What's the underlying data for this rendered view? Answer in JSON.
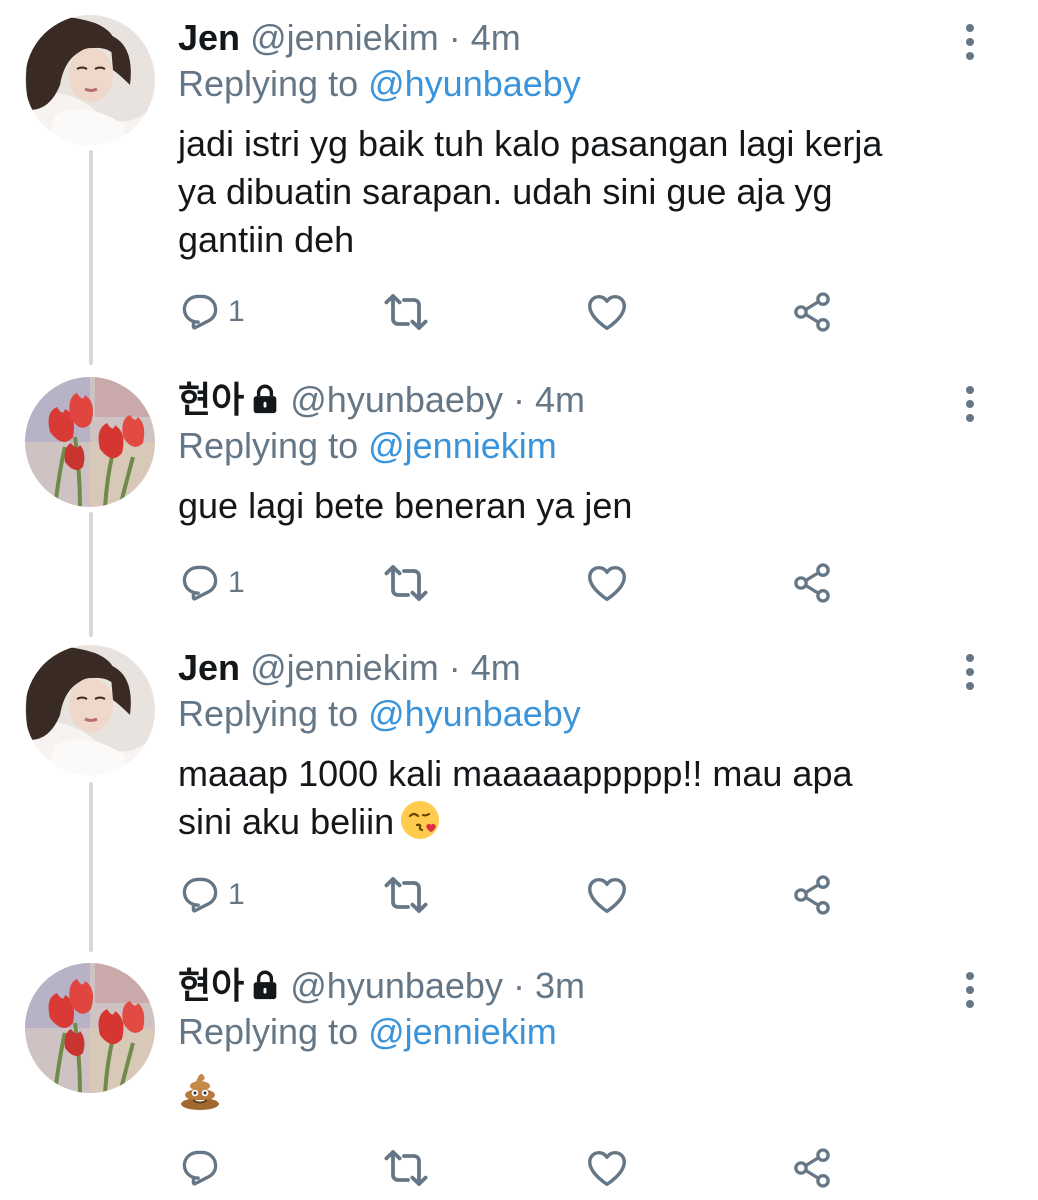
{
  "tweets": [
    {
      "name": "Jen",
      "handle": "@jenniekim",
      "separator": "·",
      "time": "4m",
      "locked": false,
      "replying_prefix": "Replying to ",
      "replying_handle": "@hyunbaeby",
      "text": "jadi istri yg baik tuh kalo pasangan lagi kerja\nya dibuatin sarapan. udah sini gue aja yg\ngantiin deh",
      "reply_count": "1",
      "avatar": "woman-portrait",
      "icons": {
        "reply": "reply-icon",
        "retweet": "retweet-icon",
        "like": "heart-icon",
        "share": "share-icon",
        "more": "more-vertical-icon"
      }
    },
    {
      "name": "현아",
      "handle": "@hyunbaeby",
      "separator": "·",
      "time": "4m",
      "locked": true,
      "replying_prefix": "Replying to ",
      "replying_handle": "@jenniekim",
      "text": "gue lagi bete beneran ya jen",
      "reply_count": "1",
      "avatar": "red-tulips"
    },
    {
      "name": "Jen",
      "handle": "@jenniekim",
      "separator": "·",
      "time": "4m",
      "locked": false,
      "replying_prefix": "Replying to ",
      "replying_handle": "@hyunbaeby",
      "text": "maaap 1000 kali maaaaappppp!! mau apa\nsini aku beliin",
      "emoji": "face-blowing-kiss-emoji",
      "reply_count": "1",
      "avatar": "woman-portrait"
    },
    {
      "name": "현아",
      "handle": "@hyunbaeby",
      "separator": "·",
      "time": "3m",
      "locked": true,
      "replying_prefix": "Replying to ",
      "replying_handle": "@jenniekim",
      "text": "",
      "emoji": "pile-of-poo-emoji",
      "reply_count": "",
      "avatar": "red-tulips"
    }
  ],
  "colors": {
    "name": "#14171a",
    "meta": "#657786",
    "link": "#3b94d9",
    "thread_line": "#d2d9df"
  }
}
